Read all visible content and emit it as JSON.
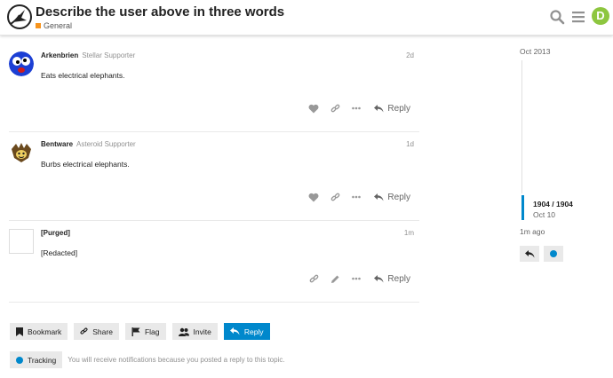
{
  "colors": {
    "accent": "#0088cc",
    "category": "#f7941d",
    "avatar_bg": "#8dc63f",
    "muted": "#919191",
    "icon": "#999999"
  },
  "header": {
    "title": "Describe the user above in three words",
    "category": "General",
    "user_initial": "D",
    "icons": [
      "search-icon",
      "hamburger-icon"
    ]
  },
  "posts": [
    {
      "username": "Arkenbrien",
      "user_title": "Stellar Supporter",
      "date": "2d",
      "body": "Eats electrical elephants.",
      "reply_label": "Reply"
    },
    {
      "username": "Bentware",
      "user_title": "Asteroid Supporter",
      "date": "1d",
      "body": "Burbs electrical elephants.",
      "reply_label": "Reply"
    },
    {
      "username": "[Purged]",
      "user_title": "",
      "date": "1m",
      "body": "[Redacted]",
      "reply_label": "Reply"
    }
  ],
  "footer_buttons": {
    "bookmark": "Bookmark",
    "share": "Share",
    "flag": "Flag",
    "invite": "Invite",
    "reply": "Reply"
  },
  "tracking": {
    "label": "Tracking",
    "text": "You will receive notifications because you posted a reply to this topic."
  },
  "timeline": {
    "start": "Oct 2013",
    "count": "1904 / 1904",
    "date": "Oct 10",
    "ago": "1m ago"
  }
}
